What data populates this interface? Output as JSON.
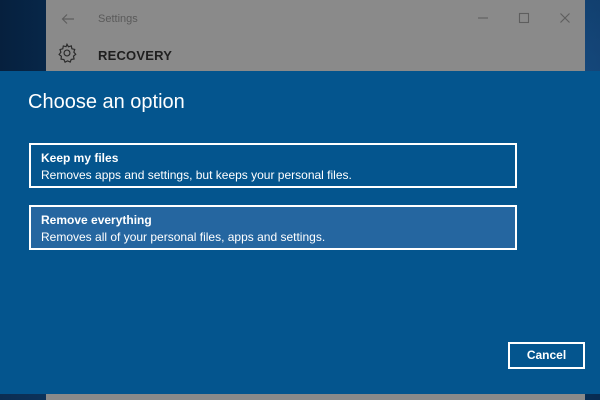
{
  "settings_window": {
    "title": "Settings",
    "page_title": "RECOVERY"
  },
  "dialog": {
    "title": "Choose an option",
    "options": [
      {
        "title": "Keep my files",
        "description": "Removes apps and settings, but keeps your personal files."
      },
      {
        "title": "Remove everything",
        "description": "Removes all of your personal files, apps and settings."
      }
    ],
    "cancel_label": "Cancel"
  },
  "colors": {
    "dialog_background": "#04558e",
    "selected_option": "#2566a0",
    "border": "#ffffff"
  },
  "icons": [
    "back-arrow-icon",
    "minimize-icon",
    "maximize-icon",
    "close-icon",
    "gear-icon"
  ]
}
